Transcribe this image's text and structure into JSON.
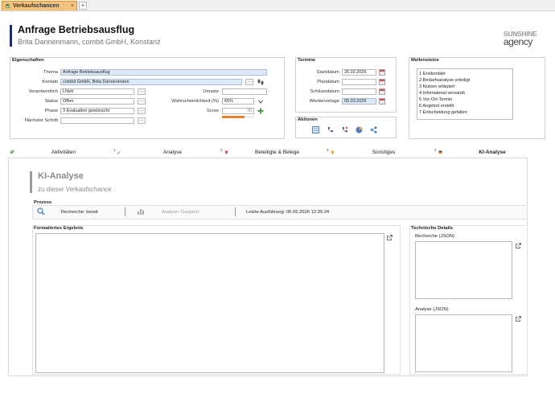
{
  "app": {
    "tab_label": "Verkaufschancen",
    "tab_close": "×",
    "add_tab": "+"
  },
  "header": {
    "title": "Anfrage Betriebsausflug",
    "subtitle": "Brita Dannenmann, combit GmbH, Konstanz",
    "logo_line1": "SUNSHINE",
    "logo_line2": "agency"
  },
  "eigenschaften": {
    "title": "Eigenschaften",
    "thema_label": "Thema",
    "thema_value": "Anfrage Betriebsausflug",
    "kontakt_label": "Kontakt",
    "kontakt_value": "combit GmbH, Brita Dannenmann",
    "verantwortlich_label": "Verantwortlich",
    "verantwortlich_value": "LNett",
    "status_label": "Status",
    "status_value": "Offen",
    "phase_label": "Phase",
    "phase_value": "3 Evaluation gewünscht",
    "naechster_label": "Nächster Schritt",
    "naechster_value": "",
    "umsatz_label": "Umsatz",
    "umsatz_value": "",
    "wahrscheinlichkeit_label": "Wahrscheinlichkeit (%)",
    "wahrscheinlichkeit_value": "65%",
    "score_label": "Score",
    "score_value": "70",
    "dots": "...",
    "score_bar_fraction": 0.7
  },
  "termine": {
    "title": "Termine",
    "startdatum_label": "Startdatum",
    "startdatum_value": "26.02.2026",
    "plandatum_label": "Plandatum",
    "plandatum_value": "",
    "schlussdatum_label": "Schlussdatum",
    "schlussdatum_value": "",
    "wiedervorlage_label": "Wiedervorlage",
    "wiedervorlage_value": "05.03.2026"
  },
  "aktionen": {
    "title": "Aktionen"
  },
  "meilensteine": {
    "title": "Meilensteine",
    "items": [
      "1 Erstkontakt",
      "2 Bedarfsanalyse erledigt",
      "3 Nutzen erläutert",
      "4 Infomaterial versandt",
      "5 Vor-Ort-Termin",
      "6 Angebot erstellt",
      "7 Entscheidung gefallen"
    ]
  },
  "tabs": [
    {
      "label": "Aktivitäten",
      "num": ""
    },
    {
      "label": "Analyse",
      "num": "1"
    },
    {
      "label": "Beteiligte & Belege",
      "num": "2"
    },
    {
      "label": "Sonstiges",
      "num": "3"
    },
    {
      "label": "KI-Analyse",
      "num": "4"
    }
  ],
  "ki": {
    "title": "KI-Analyse",
    "subtitle": "zu dieser Verkaufschance",
    "prozess_title": "Prozess",
    "recherche_status": "Recherche: bereit",
    "analyse_status": "Analyse: Gesperrt",
    "letzte_ausfuehrung": "Letzte Ausführung: 06.05.2026 12:35:24",
    "ergebnis_title": "Formatiertes Ergebnis",
    "technische_title": "Technische Details",
    "recherche_json_label": "Recherche (JSON)",
    "analyse_json_label": "Analyse (JSON)"
  },
  "colors": {
    "accent": "#1f2a6b",
    "tab_orange": "#f5c27a",
    "field_blue": "#dde9f6",
    "score_bar": "#e8822a",
    "add_green": "#3a9a3a"
  }
}
